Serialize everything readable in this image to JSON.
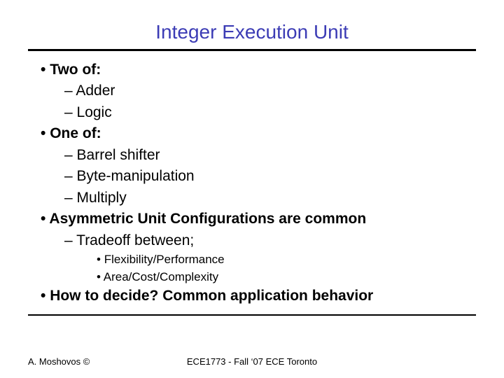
{
  "title": "Integer Execution Unit",
  "bullets": {
    "b1": "Two of:",
    "b1a": "Adder",
    "b1b": "Logic",
    "b2": "One of:",
    "b2a": "Barrel shifter",
    "b2b": "Byte-manipulation",
    "b2c": "Multiply",
    "b3": "Asymmetric Unit Configurations are common",
    "b3a": "Tradeoff between;",
    "b3a1": "Flexibility/Performance",
    "b3a2": "Area/Cost/Complexity",
    "b4": "How to decide? Common application behavior"
  },
  "footer": {
    "left": "A. Moshovos ©",
    "center": "ECE1773 - Fall ‘07 ECE Toronto"
  }
}
